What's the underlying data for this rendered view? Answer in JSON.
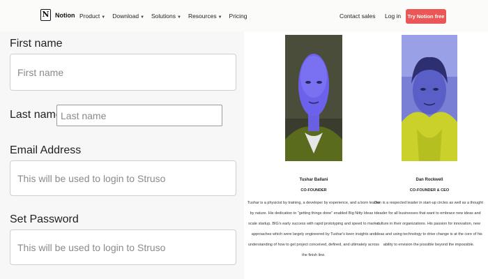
{
  "nav": {
    "logo_text": "Notion",
    "items": [
      {
        "label": "Product",
        "dropdown": true
      },
      {
        "label": "Download",
        "dropdown": true
      },
      {
        "label": "Solutions",
        "dropdown": true
      },
      {
        "label": "Resources",
        "dropdown": true
      },
      {
        "label": "Pricing",
        "dropdown": false
      }
    ],
    "contact_label": "Contact sales",
    "login_label": "Log in",
    "cta_label": "Try Notion free",
    "cta_color": "#eb5757"
  },
  "form": {
    "first_name": {
      "label": "First name",
      "placeholder": "First name"
    },
    "last_name": {
      "label": "Last name",
      "placeholder": "Last name"
    },
    "email": {
      "label": "Email Address",
      "placeholder": "This will be used to login to Struso"
    },
    "password": {
      "label": "Set Password",
      "placeholder": "This will be used to login to Struso"
    }
  },
  "team": [
    {
      "name": "Tushar Ballani",
      "role": "CO-FOUNDER",
      "bio": "Tushar is a physicist by training, a developer by experience, and a born leader by nature. His dedication to \"getting things done\" enabled Big Nitty Ideas to scale startup. BIG's early success with rapid prototyping and speed to market approaches which were largely engineered by Tushar's keen insights and understanding of how to get project conceived, defined, and ultimately across the finish line."
    },
    {
      "name": "Dan Rockwell",
      "role": "CO-FOUNDER & CEO",
      "bio": "Dan is a respected leader in start-up circles as well as a thought leader for all businesses that want to embrace new ideas and culture in their organizations. His passion for innovation, new ideas and using technology to drive change is at the core of his ability to envision the possible beyond the impossible."
    }
  ]
}
